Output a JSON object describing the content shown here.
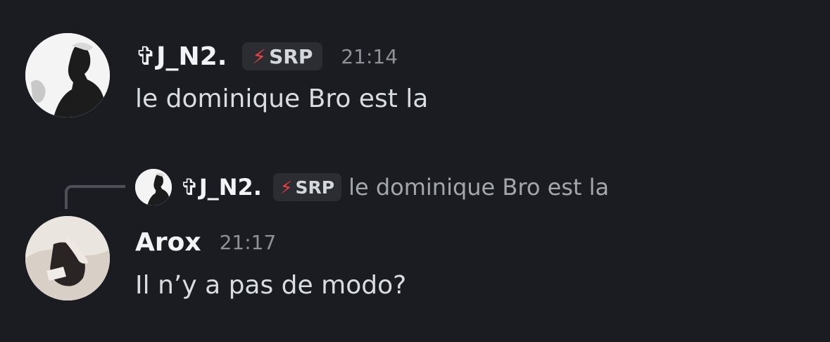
{
  "messages": [
    {
      "username": "✞J_N2.",
      "tag": {
        "icon": "lightning-bolt-icon",
        "label": "SRP"
      },
      "time": "21:14",
      "content": "le dominique Bro est la"
    },
    {
      "reply": {
        "username": "✞J_N2.",
        "tag": {
          "icon": "lightning-bolt-icon",
          "label": "SRP"
        },
        "preview": "le dominique Bro est la"
      },
      "username": "Arox",
      "time": "21:17",
      "content": "Il n’y a pas de modo?"
    }
  ],
  "colors": {
    "background": "#1b1c21",
    "tag_bg": "#2b2d33",
    "bolt": "#f23f42",
    "timestamp": "#8e9297"
  }
}
